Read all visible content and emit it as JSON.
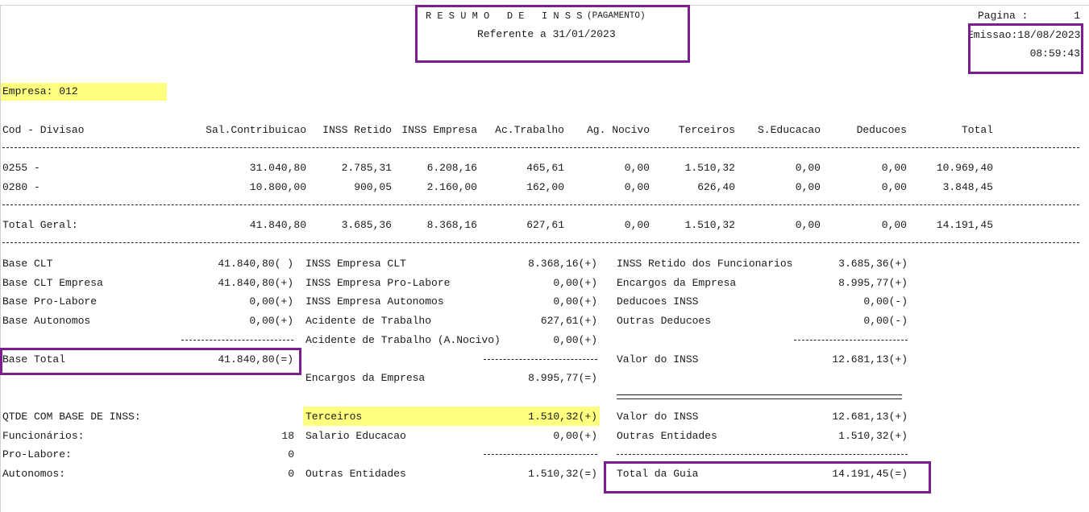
{
  "report": {
    "title": "R E S U M O   D E   I N S S",
    "title_suffix": "(PAGAMENTO)",
    "reference": "Referente a 31/01/2023",
    "page_label": "Pagina :",
    "page_number": "1",
    "emission": "Emissao:18/08/2023",
    "time": "08:59:43",
    "company": "Empresa: 012"
  },
  "table": {
    "headers": [
      "Cod - Divisao",
      "Sal.Contribuicao",
      "INSS Retido",
      "INSS Empresa",
      "Ac.Trabalho",
      "Ag. Nocivo",
      "Terceiros",
      "S.Educacao",
      "Deducoes",
      "Total"
    ],
    "rows": [
      [
        "0255 -",
        "31.040,80",
        "2.785,31",
        "6.208,16",
        "465,61",
        "0,00",
        "1.510,32",
        "0,00",
        "0,00",
        "10.969,40"
      ],
      [
        "0280 -",
        "10.800,00",
        "900,05",
        "2.160,00",
        "162,00",
        "0,00",
        "626,40",
        "0,00",
        "0,00",
        "3.848,45"
      ]
    ],
    "total": [
      "Total Geral:",
      "41.840,80",
      "3.685,36",
      "8.368,16",
      "627,61",
      "0,00",
      "1.510,32",
      "0,00",
      "0,00",
      "14.191,45"
    ]
  },
  "bases": {
    "items": [
      {
        "label": "Base CLT",
        "value": "41.840,80( )"
      },
      {
        "label": "Base CLT Empresa",
        "value": "41.840,80(+)"
      },
      {
        "label": "Base Pro-Labore",
        "value": "0,00(+)"
      },
      {
        "label": "Base Autonomos",
        "value": "0,00(+)"
      }
    ],
    "total_label": "Base Total",
    "total_value": "41.840,80(=)"
  },
  "empresa": {
    "items": [
      {
        "label": "INSS Empresa CLT",
        "value": "8.368,16(+)"
      },
      {
        "label": "INSS Empresa Pro-Labore",
        "value": "0,00(+)"
      },
      {
        "label": "INSS Empresa Autonomos",
        "value": "0,00(+)"
      },
      {
        "label": "Acidente de Trabalho",
        "value": "627,61(+)"
      },
      {
        "label": "Acidente de Trabalho (A.Nocivo)",
        "value": "0,00(+)"
      }
    ],
    "encargos_label": "Encargos da Empresa",
    "encargos_value": "8.995,77(=)",
    "terceiros_label": "Terceiros",
    "terceiros_value": "1.510,32(+)",
    "salario_label": "Salario Educacao",
    "salario_value": "0,00(+)",
    "outras_label": "Outras Entidades",
    "outras_value": "1.510,32(=)"
  },
  "inss": {
    "items": [
      {
        "label": "INSS Retido dos Funcionarios",
        "value": "3.685,36(+)"
      },
      {
        "label": "Encargos da Empresa",
        "value": "8.995,77(+)"
      },
      {
        "label": "Deducoes INSS",
        "value": "0,00(-)"
      },
      {
        "label": "Outras Deducoes",
        "value": "0,00(-)"
      }
    ],
    "valor_label": "Valor do INSS",
    "valor_value": "12.681,13(+)",
    "valor2_label": "Valor do INSS",
    "valor2_value": "12.681,13(+)",
    "outras_label": "Outras Entidades",
    "outras_value": "1.510,32(+)",
    "guia_label": "Total da Guia",
    "guia_value": "14.191,45(=)"
  },
  "qtde": {
    "title": "QTDE COM BASE DE INSS:",
    "items": [
      {
        "label": "Funcionários:",
        "value": "18"
      },
      {
        "label": "Pro-Labore:",
        "value": "0"
      },
      {
        "label": "Autonomos:",
        "value": "0"
      }
    ]
  },
  "colors": {
    "highlight": "#ffff80",
    "annotation_box": "#7b1f8c"
  }
}
